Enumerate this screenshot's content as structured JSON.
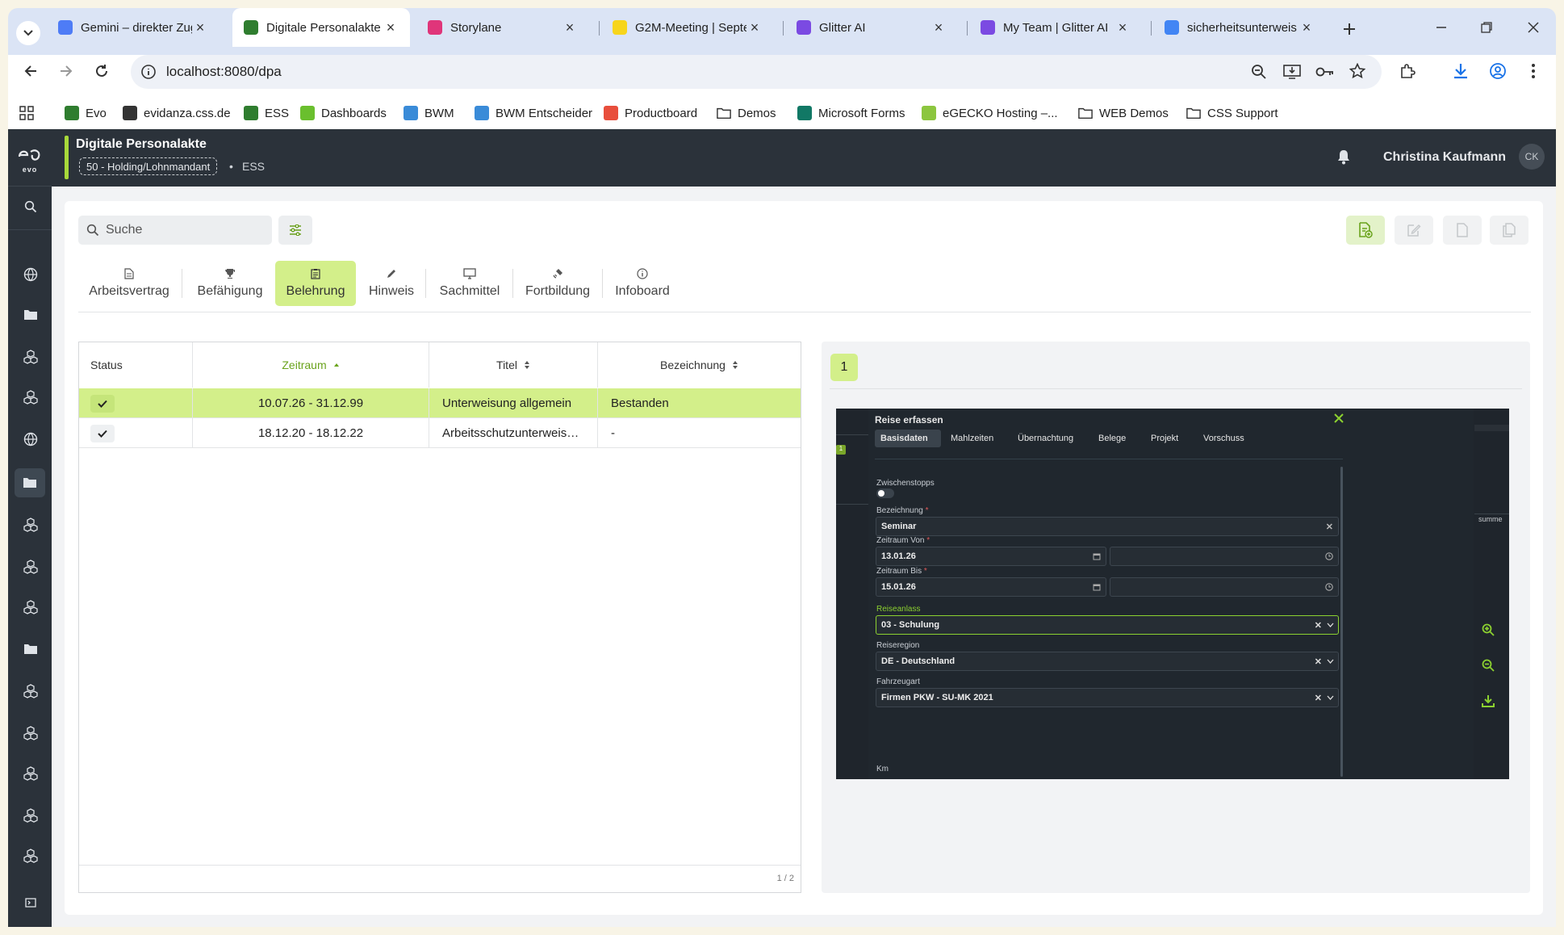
{
  "browser": {
    "tabs": [
      {
        "title": "Gemini – direkter Zug",
        "icon": "gemini-icon",
        "color": "#4e7cf6"
      },
      {
        "title": "Digitale Personalakte",
        "icon": "evo-icon",
        "color": "#2f7d2f",
        "active": true
      },
      {
        "title": "Storylane",
        "icon": "storylane-icon",
        "color": "#e0357a"
      },
      {
        "title": "G2M-Meeting | Septe",
        "icon": "miro-icon",
        "color": "#f7d51c"
      },
      {
        "title": "Glitter AI",
        "icon": "glitter-icon",
        "color": "#7b4ae2"
      },
      {
        "title": "My Team | Glitter AI",
        "icon": "glitter-icon",
        "color": "#7b4ae2"
      },
      {
        "title": "sicherheitsunterweis",
        "icon": "google-icon",
        "color": "#4285f4"
      }
    ],
    "url": "localhost:8080/dpa",
    "bookmarks": [
      {
        "label": "Evo",
        "color": "#2f7d2f"
      },
      {
        "label": "evidanza.css.de",
        "color": "#333"
      },
      {
        "label": "ESS",
        "color": "#2f7d2f"
      },
      {
        "label": "Dashboards",
        "color": "#6abf2e"
      },
      {
        "label": "BWM",
        "color": "#3a8bd8"
      },
      {
        "label": "BWM Entscheider",
        "color": "#3a8bd8"
      },
      {
        "label": "Productboard",
        "color": "#e84e3c"
      },
      {
        "label": "Demos",
        "color": "folder"
      },
      {
        "label": "Microsoft Forms",
        "color": "#117865"
      },
      {
        "label": "eGECKO Hosting –...",
        "color": "#8cc63f"
      },
      {
        "label": "WEB Demos",
        "color": "folder"
      },
      {
        "label": "CSS Support",
        "color": "folder"
      }
    ]
  },
  "app": {
    "logo": "evo",
    "title": "Digitale Personalakte",
    "client_badge": "50 - Holding/Lohnmandant",
    "context": "ESS",
    "user_name": "Christina Kaufmann",
    "user_initials": "CK",
    "accent": "#a8d93a"
  },
  "search": {
    "placeholder": "Suche"
  },
  "tabs": [
    {
      "label": "Arbeitsvertrag",
      "icon": "document-icon"
    },
    {
      "label": "Befähigung",
      "icon": "trophy-icon"
    },
    {
      "label": "Belehrung",
      "icon": "clipboard-icon",
      "active": true
    },
    {
      "label": "Hinweis",
      "icon": "pencil-icon"
    },
    {
      "label": "Sachmittel",
      "icon": "monitor-icon"
    },
    {
      "label": "Fortbildung",
      "icon": "satellite-icon"
    },
    {
      "label": "Infoboard",
      "icon": "info-icon"
    }
  ],
  "table": {
    "columns": [
      "Status",
      "Zeitraum",
      "Titel",
      "Bezeichnung"
    ],
    "rows": [
      {
        "status": "check",
        "zeitraum": "10.07.26 - 31.12.99",
        "titel": "Unterweisung allgemein",
        "bezeichnung": "Bestanden",
        "selected": true
      },
      {
        "status": "check",
        "zeitraum": "18.12.20 - 18.12.22",
        "titel": "Arbeitsschutzunterweisung",
        "bezeichnung": "-"
      }
    ],
    "pagination": "1 / 2"
  },
  "preview": {
    "page_badge": "1",
    "dialog": {
      "title": "Reise erfassen",
      "tabs": [
        "Basisdaten",
        "Mahlzeiten",
        "Übernachtung",
        "Belege",
        "Projekt",
        "Vorschuss"
      ],
      "zwischenstopps_label": "Zwischenstopps",
      "bezeichnung_label": "Bezeichnung",
      "bezeichnung_value": "Seminar",
      "zeitraum_von_label": "Zeitraum Von",
      "zeitraum_von_value": "13.01.26",
      "zeitraum_bis_label": "Zeitraum Bis",
      "zeitraum_bis_value": "15.01.26",
      "reiseanlass_label": "Reiseanlass",
      "reiseanlass_value": "03 - Schulung",
      "reiseregion_label": "Reiseregion",
      "reiseregion_value": "DE - Deutschland",
      "fahrzeugart_label": "Fahrzeugart",
      "fahrzeugart_value": "Firmen PKW - SU-MK 2021",
      "km_label": "Km",
      "side_text": "summe",
      "side_badge": "1"
    }
  }
}
